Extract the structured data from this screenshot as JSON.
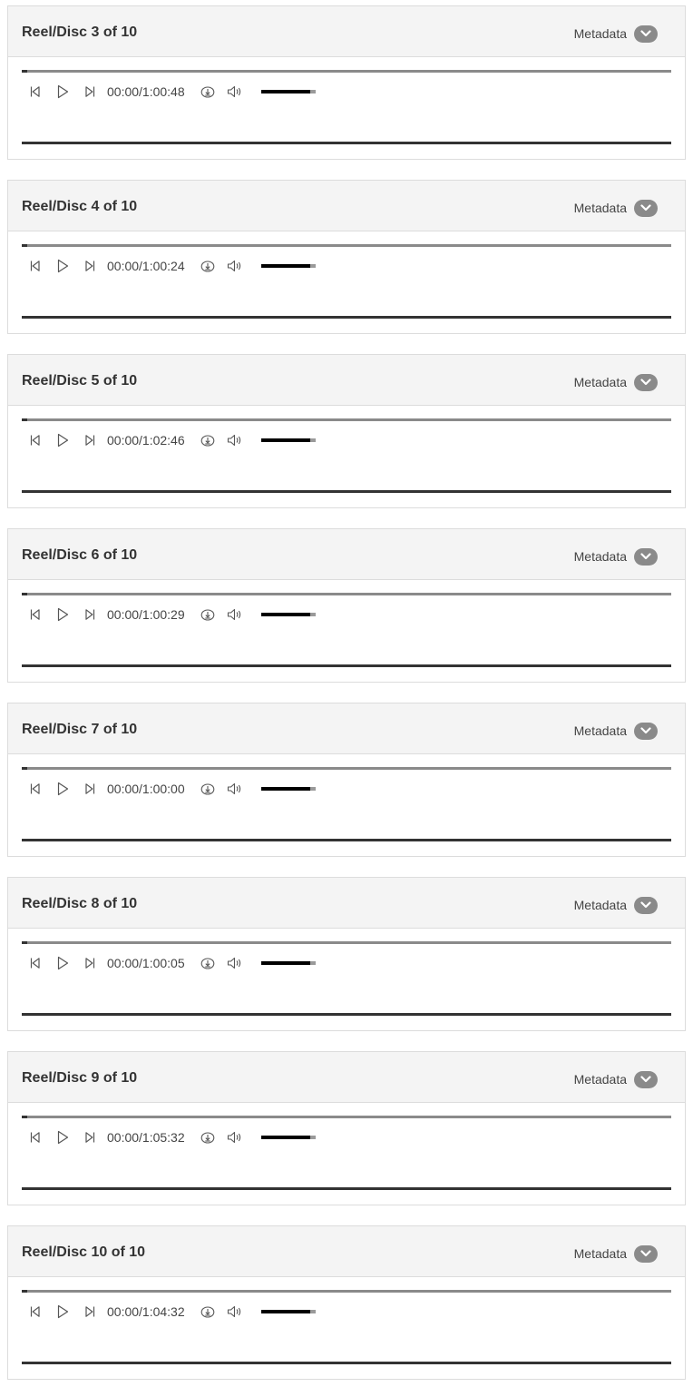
{
  "reels": [
    {
      "title": "Reel/Disc 3 of 10",
      "metadata_label": "Metadata",
      "time": "00:00/1:00:48",
      "volume": 0.9
    },
    {
      "title": "Reel/Disc 4 of 10",
      "metadata_label": "Metadata",
      "time": "00:00/1:00:24",
      "volume": 0.9
    },
    {
      "title": "Reel/Disc 5 of 10",
      "metadata_label": "Metadata",
      "time": "00:00/1:02:46",
      "volume": 0.9
    },
    {
      "title": "Reel/Disc 6 of 10",
      "metadata_label": "Metadata",
      "time": "00:00/1:00:29",
      "volume": 0.9
    },
    {
      "title": "Reel/Disc 7 of 10",
      "metadata_label": "Metadata",
      "time": "00:00/1:00:00",
      "volume": 0.9
    },
    {
      "title": "Reel/Disc 8 of 10",
      "metadata_label": "Metadata",
      "time": "00:00/1:00:05",
      "volume": 0.9
    },
    {
      "title": "Reel/Disc 9 of 10",
      "metadata_label": "Metadata",
      "time": "00:00/1:05:32",
      "volume": 0.9
    },
    {
      "title": "Reel/Disc 10 of 10",
      "metadata_label": "Metadata",
      "time": "00:00/1:04:32",
      "volume": 0.9
    }
  ],
  "icons": {
    "metadata_toggle": "chevron-down-icon",
    "previous": "skip-previous-icon",
    "play": "play-icon",
    "next": "skip-next-icon",
    "download": "download-icon",
    "volume": "volume-icon"
  }
}
